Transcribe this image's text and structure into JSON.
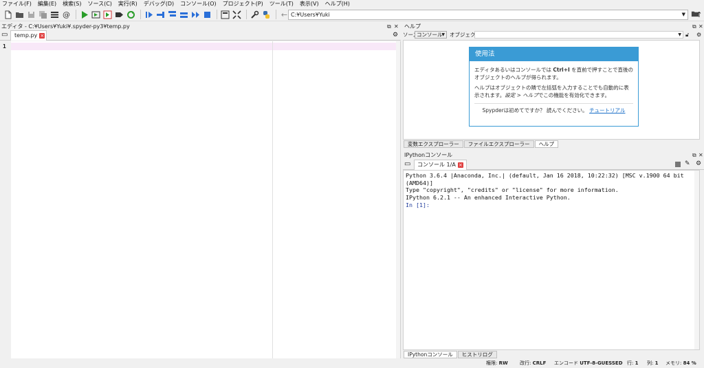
{
  "menubar": [
    "ファイル(F)",
    "編集(E)",
    "検索(S)",
    "ソース(C)",
    "実行(R)",
    "デバッグ(D)",
    "コンソール(O)",
    "プロジェクト(P)",
    "ツール(T)",
    "表示(V)",
    "ヘルプ(H)"
  ],
  "toolbar": {
    "path": "C:¥Users¥Yuki"
  },
  "editor": {
    "title": "エディタ - C:¥Users¥Yuki¥.spyder-py3¥temp.py",
    "tab": "temp.py",
    "line_number": "1"
  },
  "help": {
    "title": "ヘルプ",
    "source_label": "ソース",
    "source_value": "コンソール",
    "object_label": "オブジェクト",
    "card_title": "使用法",
    "p1a": "エディタあるいはコンソールでは ",
    "p1_key": "Ctrl+I",
    "p1b": " を直前で押すことで直後のオブジェクトのヘルプが得られます。",
    "p2a": "ヘルプはオブジェクトの隣で左括弧を入力することでも自動的に表示されます。",
    "p2_em": "設定 > ヘルプ",
    "p2b": "でこの機能を有効化できます。",
    "p3": "Spypderは初めてですか？ 読んでください。",
    "p3_link": "チュートリアル",
    "tabs": [
      "変数エクスプローラー",
      "ファイルエクスプローラー",
      "ヘルプ"
    ]
  },
  "console": {
    "title": "IPythonコンソール",
    "tab": "コンソール 1/A",
    "lines": [
      "Python 3.6.4 |Anaconda, Inc.| (default, Jan 16 2018, 10:22:32) [MSC v.1900 64 bit",
      "(AMD64)]",
      "Type \"copyright\", \"credits\" or \"license\" for more information.",
      "",
      "IPython 6.2.1 -- An enhanced Interactive Python.",
      ""
    ],
    "prompt": "In [1]:",
    "tabs": [
      "IPythonコンソール",
      "ヒストリログ"
    ]
  },
  "status": {
    "perm_label": "権限:",
    "perm_value": "RW",
    "eol_label": "改行:",
    "eol_value": "CRLF",
    "enc_label": "エンコード",
    "enc_value": "UTF-8-GUESSED",
    "line_label": "行:",
    "line_value": "1",
    "col_label": "列:",
    "col_value": "1",
    "mem_label": "メモリ:",
    "mem_value": "84 %"
  },
  "colors": {
    "accent": "#3a9bd5",
    "run": "#2a9d2a",
    "current_line": "#f8e8f8",
    "link": "#1a6fc8"
  }
}
